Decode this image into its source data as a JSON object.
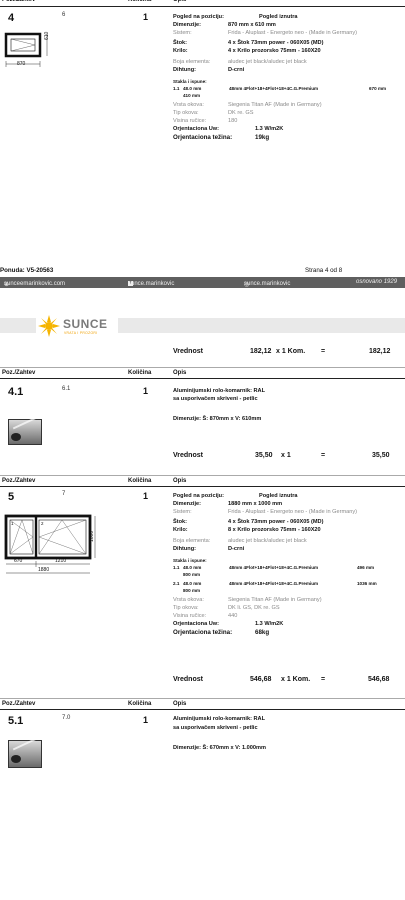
{
  "header": {
    "poz": "Poz./Zahtev",
    "kolicina": "Količina",
    "opis": "Opis"
  },
  "item4": {
    "number": "4",
    "sub": "6",
    "qty": "1",
    "pogled_label": "Pogled na poziciju:",
    "pogled_val": "Pogled iznutra",
    "dim_label": "Dimenzije:",
    "dim_val": "870 mm x 610 mm",
    "sistem_label": "Sistem:",
    "sistem_val": "Frida - Aluplast - Energeto neo - (Made in Germany)",
    "stok_label": "Štok:",
    "stok_val": "4 x Štok 73mm power - 060X05 (MD)",
    "krilo_label": "Krilo:",
    "krilo_val": "4 x Krilo prozorsko 75mm - 160X20",
    "boja_label": "Boja elementa:",
    "boja_val": "aludec jet black/aludec jet black",
    "dihtung_label": "Dihtung:",
    "dihtung_val": "D-crni",
    "stakla_label": "Stakla i ispune:",
    "glass": [
      {
        "idx": "1.1",
        "w": "48.0 mm",
        "h": "410 mm",
        "desc": "48mm 4Flot+18+4Flot+18+4C.G.Premium",
        "size": "670 mm"
      }
    ],
    "okov_label": "Vrsta okova:",
    "okov_val": "Siegenia Titan AF (Made in Germany)",
    "tip_label": "Tip okova:",
    "tip_val": "DK re. GS",
    "visina_label": "Visina ručice:",
    "visina_val": "180",
    "uw_label": "Orjentaciona Uw:",
    "uw_val": "1.3 W/m2K",
    "tezina_label": "Orjentaciona težina:",
    "tezina_val": "19kg",
    "dim_h": "610",
    "dim_w": "870"
  },
  "footer": {
    "ponuda": "Ponuda: V5-20563",
    "strana": "Strana 4 od 8",
    "web": "sunceemarinkovic.com",
    "fb": "sunce.marinkovic",
    "ig": "sunce.marinkovic",
    "osnovano": "osnovano 1929"
  },
  "logo": {
    "name": "SUNCE",
    "tag": "VRATA I PROZORI"
  },
  "vred4": {
    "label": "Vrednost",
    "price": "182,12",
    "mult": "x 1 Kom.",
    "eq": "=",
    "total": "182,12"
  },
  "item41": {
    "number": "4.1",
    "sub": "6.1",
    "qty": "1",
    "line1": "Aluminijumski rolo-komarnik: RAL",
    "line2": "sa usporivačem skriveni - petlic",
    "dim": "Dimenzije:  Š: 870mm x V: 610mm",
    "v_label": "Vrednost",
    "v_price": "35,50",
    "v_mult": "x 1",
    "v_eq": "=",
    "v_total": "35,50"
  },
  "item5": {
    "number": "5",
    "sub": "7",
    "qty": "1",
    "pogled_label": "Pogled na poziciju:",
    "pogled_val": "Pogled iznutra",
    "dim_label": "Dimenzije:",
    "dim_val": "1880 mm x 1000 mm",
    "sistem_label": "Sistem:",
    "sistem_val": "Frida - Aluplast - Energeto neo - (Made in Germany)",
    "stok_label": "Štok:",
    "stok_val": "4 x Štok 73mm power - 060X05 (MD)",
    "krilo_label": "Krilo:",
    "krilo_val": "8 x Krilo prozorsko 75mm - 160X20",
    "boja_label": "Boja elementa:",
    "boja_val": "aludec jet black/aludec jet black",
    "dihtung_label": "Dihtung:",
    "dihtung_val": "D-crni",
    "stakla_label": "Stakla i ispune:",
    "glass": [
      {
        "idx": "1.1",
        "w": "48.0 mm",
        "h": "800 mm",
        "desc": "48mm 4Flot+18+4Flot+18+4C.G.Premium",
        "size": "496 mm"
      },
      {
        "idx": "2.1",
        "w": "48.0 mm",
        "h": "800 mm",
        "desc": "48mm 4Flot+18+4Flot+18+4C.G.Premium",
        "size": "1036 mm"
      }
    ],
    "okov_label": "Vrsta okova:",
    "okov_val": "Siegenia Titan AF (Made in Germany)",
    "tip_label": "Tip okova:",
    "tip_val": "DK li. GS, DK re. GS",
    "visina_label": "Visina ručice:",
    "visina_val": "440",
    "uw_label": "Orjentaciona Uw:",
    "uw_val": "1.3 W/m2K",
    "tezina_label": "Orjentaciona težina:",
    "tezina_val": "68kg",
    "dim_h": "1000",
    "dim_w1": "670",
    "dim_w2": "1210",
    "dim_w": "1880",
    "pane1": "1",
    "pane2": "2",
    "v_label": "Vrednost",
    "v_price": "546,68",
    "v_mult": "x 1 Kom.",
    "v_eq": "=",
    "v_total": "546,68"
  },
  "item51": {
    "number": "5.1",
    "sub": "7.0",
    "qty": "1",
    "line1": "Aluminijumski rolo-komarnik: RAL",
    "line2": "sa usporivačem skriveni - petlic",
    "dim": "Dimenzije:  Š: 670mm x V: 1.000mm"
  }
}
